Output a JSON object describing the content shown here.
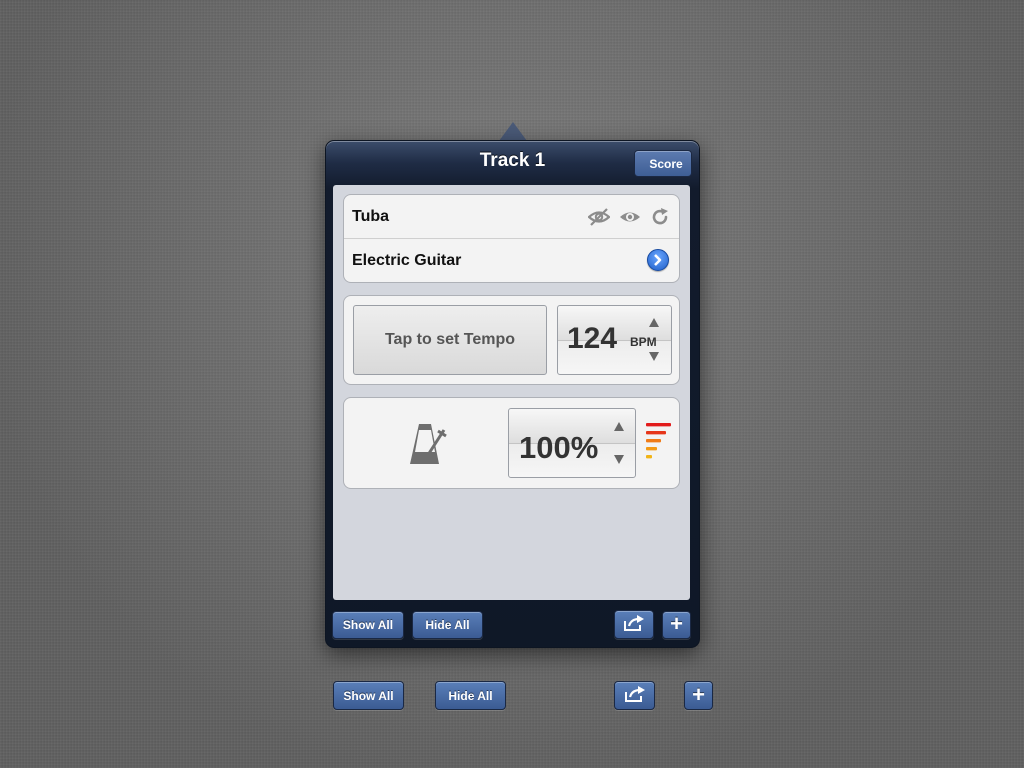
{
  "popover": {
    "title": "Track 1",
    "score_label": "Score"
  },
  "instruments": {
    "rows": [
      {
        "label": "Tuba",
        "icons": [
          "eye-hidden-icon",
          "eye-icon",
          "refresh-icon"
        ]
      },
      {
        "label": "Electric Guitar",
        "icons": [
          "disclosure-arrow-icon"
        ]
      }
    ]
  },
  "tempo": {
    "tap_label": "Tap to set Tempo",
    "bpm_value": "124",
    "bpm_unit": "BPM"
  },
  "metronome": {
    "icon": "metronome-icon",
    "volume_value": "100%",
    "level_icon": "volume-level-icon"
  },
  "toolbar": {
    "show_all_label": "Show All",
    "hide_all_label": "Hide All",
    "share_icon": "share-icon",
    "add_icon": "plus-icon",
    "add_glyph": "+"
  },
  "colors": {
    "nav_bar": "#1f2c45",
    "button_blue": "#3e5e95",
    "level_red": "#e21b1b",
    "level_orange": "#f07b17",
    "level_yellow": "#f1b417"
  }
}
